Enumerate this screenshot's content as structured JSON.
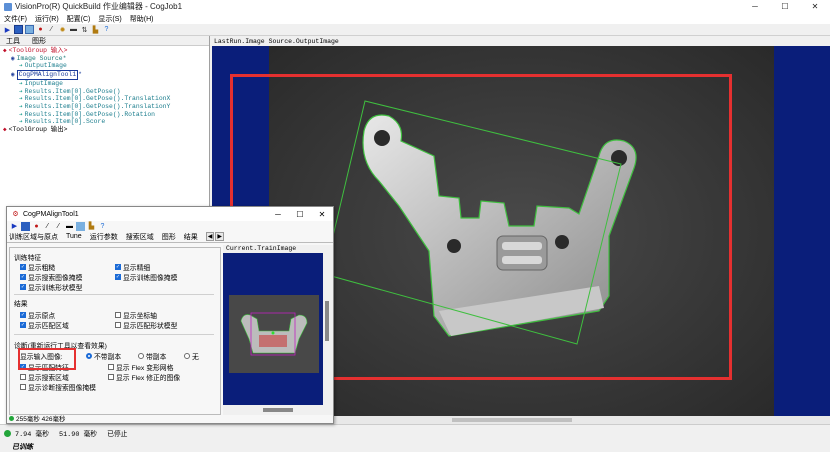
{
  "window": {
    "title": "VisionPro(R) QuickBuild 作业编辑器 - CogJob1"
  },
  "menu": [
    "文件(F)",
    "运行(R)",
    "配置(C)",
    "显示(S)",
    "帮助(H)"
  ],
  "left_tabs": [
    "工具",
    "图形"
  ],
  "tree": [
    {
      "text": "<ToolGroup 输入>",
      "color": "#c0102a",
      "indent": 0
    },
    {
      "text": "Image Source",
      "suffix": "*",
      "color": "#1a7a7a",
      "indent": 1
    },
    {
      "text": "OutputImage",
      "color": "#1b7d8d",
      "indent": 2
    },
    {
      "text": "CogPMAlignTool1",
      "suffix": "*",
      "color": "#1a3a9a",
      "indent": 1
    },
    {
      "text": "InputImage",
      "color": "#1b7d8d",
      "indent": 2
    },
    {
      "text": "Results.Item[0].GetPose()",
      "color": "#1b7d8d",
      "indent": 2
    },
    {
      "text": "Results.Item[0].GetPose().TranslationX",
      "color": "#1b7d8d",
      "indent": 2
    },
    {
      "text": "Results.Item[0].GetPose().TranslationY",
      "color": "#1b7d8d",
      "indent": 2
    },
    {
      "text": "Results.Item[0].GetPose().Rotation",
      "color": "#1b7d8d",
      "indent": 2
    },
    {
      "text": "Results.Item[0].Score",
      "color": "#1b7d8d",
      "indent": 2
    },
    {
      "text": "<ToolGroup 输出>",
      "color": "#000000",
      "indent": 0
    }
  ],
  "display": {
    "title": "LastRun.Image Source.OutputImage"
  },
  "status": {
    "time1": "7.94 毫秒",
    "time2": "51.90 毫秒",
    "state": "已停止"
  },
  "dialog": {
    "title": "CogPMAlignTool1",
    "tabs": [
      "训练区域与原点",
      "Tune",
      "运行参数",
      "搜索区域",
      "图形",
      "结果"
    ],
    "current_image": "Current.TrainImage",
    "group_train": "训练特征",
    "chk_train_coarse": "显示粗糙",
    "chk_train_fine": "显示精细",
    "chk_train_mask": "显示搜索图像掩模",
    "chk_train_mask2": "显示训练图像掩模",
    "chk_train_shape": "显示训练形状模型",
    "group_result": "结果",
    "chk_origin": "显示原点",
    "chk_axis": "显示坐标轴",
    "chk_match_region": "显示匹配区域",
    "chk_match_shape": "显示匹配形状模型",
    "group_diag": "诊断(重新运行工具以查看效果)",
    "diag_input_label": "显示输入图像:",
    "radio_no_copy": "不带副本",
    "radio_copy": "带副本",
    "radio_none": "无",
    "chk_match_feat": "显示匹配特征",
    "chk_flex_grid": "显示 Flex 变形网格",
    "chk_search_region": "显示搜索区域",
    "chk_flex_corr": "显示 Flex 修正的图像",
    "chk_diag_mask": "显示诊断搜索图像掩模",
    "trained": "已训练",
    "stat_time1": "255毫秒",
    "stat_time2": "426毫秒"
  },
  "icons": [
    "run-icon",
    "open-icon",
    "save-icon",
    "settings-icon",
    "help-icon"
  ],
  "colors": {
    "display_bg": "#0a1e7a",
    "highlight": "#e53030",
    "graphic_green": "#3fbf3f"
  }
}
